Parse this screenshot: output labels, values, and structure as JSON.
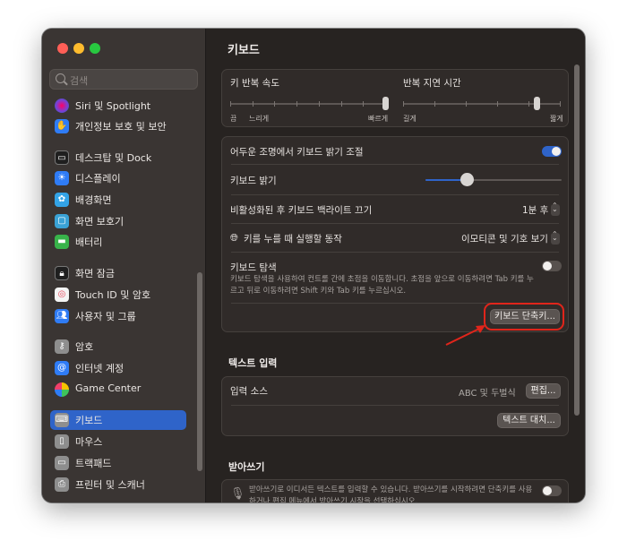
{
  "window": {
    "traffic_colors": [
      "#ff5f57",
      "#febc2e",
      "#28c840"
    ]
  },
  "sidebar": {
    "search_placeholder": "검색",
    "items": [
      {
        "label": "Siri 및 Spotlight",
        "icon": "siri-icon",
        "color": "#7a3fd4"
      },
      {
        "label": "개인정보 보호 및 보안",
        "icon": "hand-icon",
        "color": "#2f7cf6"
      },
      {
        "label": "데스크탑 및 Dock",
        "icon": "dock-icon",
        "color": "#2b2b2b"
      },
      {
        "label": "디스플레이",
        "icon": "sun-icon",
        "color": "#2f7cf6"
      },
      {
        "label": "배경화면",
        "icon": "flower-icon",
        "color": "#33a3e6"
      },
      {
        "label": "화면 보호기",
        "icon": "screensaver-icon",
        "color": "#3aa2d5"
      },
      {
        "label": "배터리",
        "icon": "battery-icon",
        "color": "#38b34a"
      },
      {
        "label": "화면 잠금",
        "icon": "lock-icon",
        "color": "#2b2b2b"
      },
      {
        "label": "Touch ID 및 암호",
        "icon": "fingerprint-icon",
        "color": "#f4f4f4"
      },
      {
        "label": "사용자 및 그룹",
        "icon": "users-icon",
        "color": "#2f7cf6"
      },
      {
        "label": "암호",
        "icon": "key-icon",
        "color": "#8e8e8e"
      },
      {
        "label": "인터넷 계정",
        "icon": "at-icon",
        "color": "#2f7cf6"
      },
      {
        "label": "Game Center",
        "icon": "gamecenter-icon",
        "color": "#ffffff"
      },
      {
        "label": "키보드",
        "icon": "keyboard-icon",
        "color": "#8e8e8e"
      },
      {
        "label": "마우스",
        "icon": "mouse-icon",
        "color": "#8e8e8e"
      },
      {
        "label": "트랙패드",
        "icon": "trackpad-icon",
        "color": "#8e8e8e"
      },
      {
        "label": "프린터 및 스캐너",
        "icon": "printer-icon",
        "color": "#8e8e8e"
      }
    ],
    "active_item": "키보드"
  },
  "main": {
    "title": "키보드",
    "repeat": {
      "key_repeat_label": "키 반복 속도",
      "delay_label": "반복 지연 시간",
      "repeat_min": "끔",
      "repeat_slow": "느리게",
      "repeat_fast": "빠르게",
      "delay_long": "길게",
      "delay_short": "짧게",
      "key_repeat_level": 1.0,
      "delay_level": 0.85
    },
    "settings": {
      "adjust_brightness_label": "어두운 조명에서 키보드 밝기 조절",
      "adjust_brightness_on": true,
      "brightness_label": "키보드 밝기",
      "brightness_level": 0.3,
      "backlight_off_label": "비활성화된 후 키보드 백라이트 끄기",
      "backlight_off_value": "1분 후",
      "globe_key_label": "키를 누를 때 실행할 동작",
      "globe_key_value": "이모티콘 및 기호 보기",
      "keyboard_nav_label": "키보드 탐색",
      "keyboard_nav_desc": "키보드 탐색을 사용하여 컨트롤 간에 초점을 이동합니다. 초점을 앞으로 이동하려면 Tab 키를 누르고 뒤로 이동하려면 Shift 키와 Tab 키를 누르십시오.",
      "keyboard_nav_on": false,
      "shortcuts_button": "키보드 단축키...",
      "highlight_color": "#e0251b"
    },
    "text_input": {
      "section_title": "텍스트 입력",
      "input_sources_label": "입력 소스",
      "input_sources_value": "ABC 및 두벌식",
      "edit_button": "편집...",
      "text_replace_button": "텍스트 대치..."
    },
    "dictation": {
      "section_title": "받아쓰기",
      "desc": "받아쓰기로 이디서든 텍스트를 입력할 수 있습니다. 받아쓰기를 시작하려면 단축키를 사용하거나 편집 메뉴에서 받아쓰기 시작을 선택하십시오.",
      "on": false
    }
  }
}
